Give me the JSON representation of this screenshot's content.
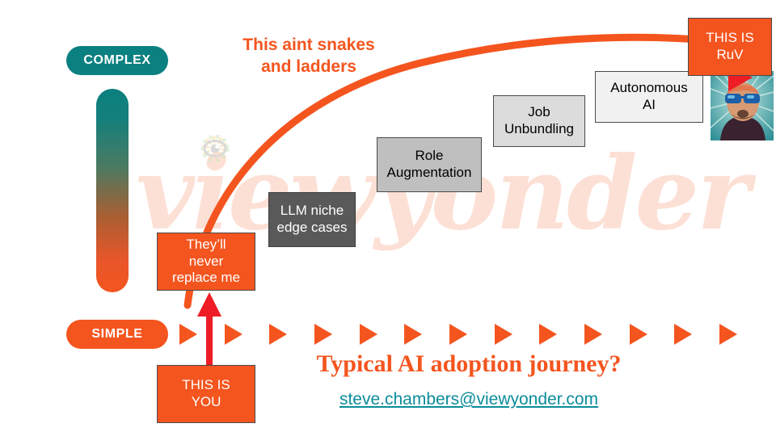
{
  "slide": {
    "background_color": "#ffffff",
    "accent_orange": "#f4551f",
    "accent_teal": "#0b8080",
    "link_teal": "#0b8c9b",
    "red": "#ee1c25"
  },
  "watermark": {
    "text": "viewyonder",
    "color": "#fde0d5",
    "logo_icon": "eye-icon"
  },
  "scale": {
    "top_label": "COMPLEX",
    "bottom_label": "SIMPLE",
    "gradient_from": "#0b7f7f",
    "gradient_to": "#f4551f"
  },
  "headings": {
    "callout": "This aint snakes\nand ladders",
    "callout_line1": "This aint snakes",
    "callout_line2": "and ladders",
    "title": "Typical AI adoption journey?",
    "email": "steve.chambers@viewyonder.com"
  },
  "stages": [
    {
      "id": "theyll-never-replace-me",
      "label": "They’ll\nnever\nreplace me",
      "style": "orange"
    },
    {
      "id": "llm-niche-edge-cases",
      "label": "LLM niche\nedge cases",
      "style": "dark-gray"
    },
    {
      "id": "role-augmentation",
      "label": "Role\nAugmentation",
      "style": "mid-gray"
    },
    {
      "id": "job-unbundling",
      "label": "Job\nUnbundling",
      "style": "light-gray"
    },
    {
      "id": "autonomous-ai",
      "label": "Autonomous\nAI",
      "style": "pale-gray"
    },
    {
      "id": "this-is-ruv",
      "label": "THIS IS\nRuV",
      "style": "orange"
    }
  ],
  "you_marker": {
    "label": "THIS IS\nYOU",
    "arrow_color": "#ee1c25",
    "arrow_direction": "up"
  },
  "progress_arrows": {
    "count": 13,
    "color": "#f4551f",
    "shape": "triangle-right"
  },
  "avatar": {
    "name": "ruv-avatar",
    "description": "stylized portrait with sunglasses on teal sunburst background"
  },
  "play_button": {
    "name": "play-triangle-icon",
    "color": "#ee1c25"
  },
  "chart_data": {
    "type": "line",
    "title": "Typical AI adoption journey?",
    "xlabel": "",
    "ylabel": "Complexity",
    "ylim": [
      "SIMPLE",
      "COMPLEX"
    ],
    "grid": false,
    "legend": "none",
    "annotations": [
      "This aint snakes and ladders",
      "THIS IS YOU",
      "THIS IS RuV"
    ],
    "categories": [
      "They’ll never replace me",
      "LLM niche edge cases",
      "Role Augmentation",
      "Job Unbundling",
      "Autonomous AI",
      "THIS IS RuV"
    ],
    "values": [
      1,
      2,
      3,
      4,
      5,
      6
    ],
    "curve": "rising concave arc from lower-left to upper-right"
  }
}
